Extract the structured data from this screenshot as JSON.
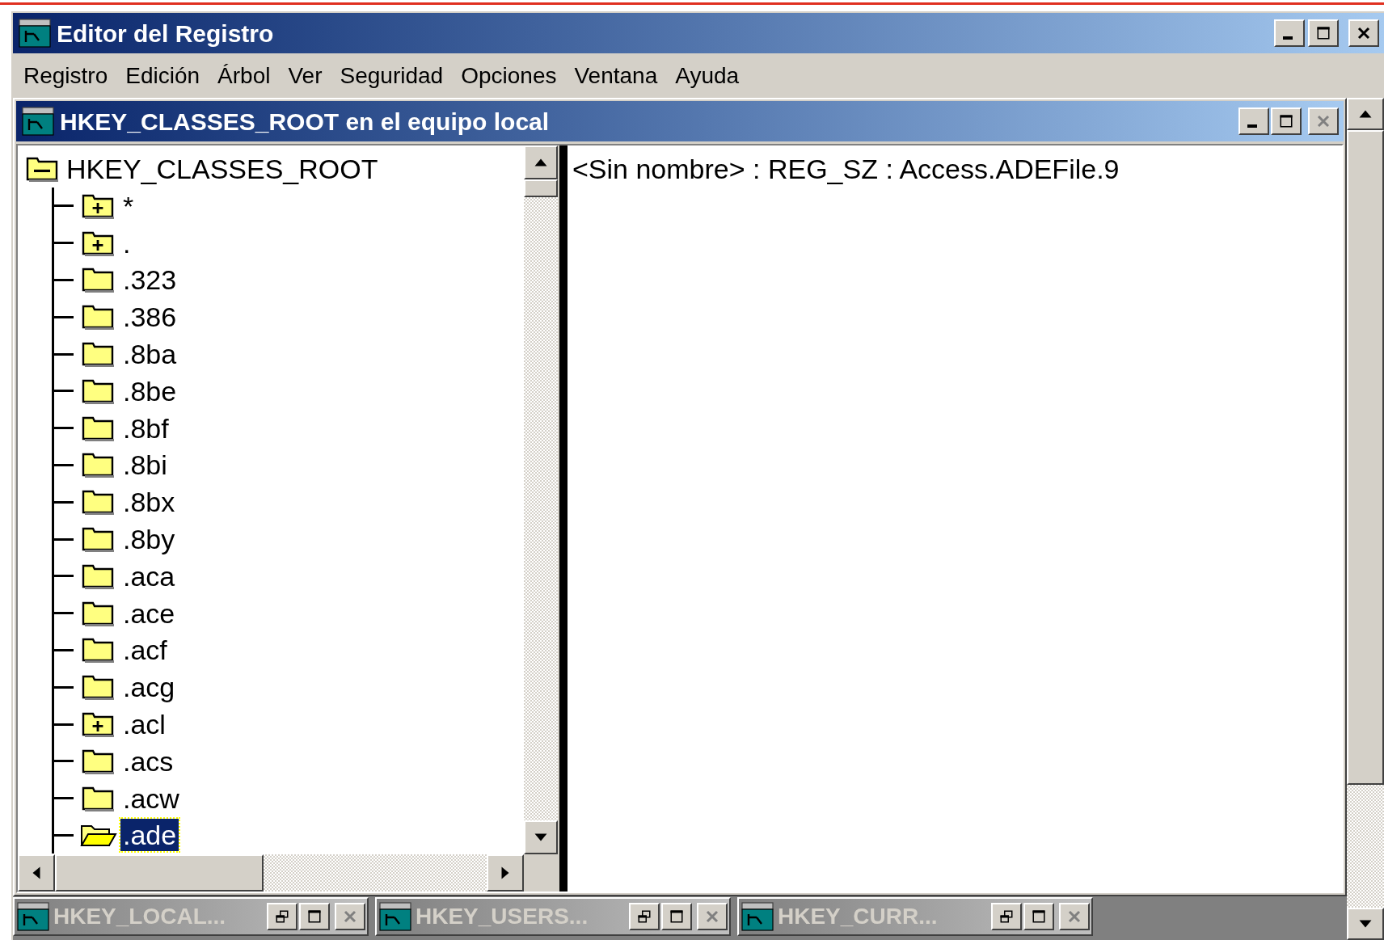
{
  "window": {
    "title": "Editor del Registro"
  },
  "menu": [
    "Registro",
    "Edición",
    "Árbol",
    "Ver",
    "Seguridad",
    "Opciones",
    "Ventana",
    "Ayuda"
  ],
  "child_window": {
    "title": "HKEY_CLASSES_ROOT en el equipo local",
    "tree": {
      "label": "HKEY_CLASSES_ROOT",
      "expanded": true,
      "children": [
        {
          "label": "*",
          "expandable": true,
          "selected": false
        },
        {
          "label": ".",
          "expandable": true,
          "selected": false
        },
        {
          "label": ".323",
          "expandable": false,
          "selected": false
        },
        {
          "label": ".386",
          "expandable": false,
          "selected": false
        },
        {
          "label": ".8ba",
          "expandable": false,
          "selected": false
        },
        {
          "label": ".8be",
          "expandable": false,
          "selected": false
        },
        {
          "label": ".8bf",
          "expandable": false,
          "selected": false
        },
        {
          "label": ".8bi",
          "expandable": false,
          "selected": false
        },
        {
          "label": ".8bx",
          "expandable": false,
          "selected": false
        },
        {
          "label": ".8by",
          "expandable": false,
          "selected": false
        },
        {
          "label": ".aca",
          "expandable": false,
          "selected": false
        },
        {
          "label": ".ace",
          "expandable": false,
          "selected": false
        },
        {
          "label": ".acf",
          "expandable": false,
          "selected": false
        },
        {
          "label": ".acg",
          "expandable": false,
          "selected": false
        },
        {
          "label": ".acl",
          "expandable": true,
          "selected": false
        },
        {
          "label": ".acs",
          "expandable": false,
          "selected": false
        },
        {
          "label": ".acw",
          "expandable": false,
          "selected": false
        },
        {
          "label": ".ade",
          "expandable": false,
          "selected": true
        }
      ]
    },
    "values": [
      "<Sin nombre> : REG_SZ : Access.ADEFile.9"
    ]
  },
  "minimized_windows": [
    {
      "title": "HKEY_LOCAL..."
    },
    {
      "title": "HKEY_USERS..."
    },
    {
      "title": "HKEY_CURR..."
    }
  ]
}
